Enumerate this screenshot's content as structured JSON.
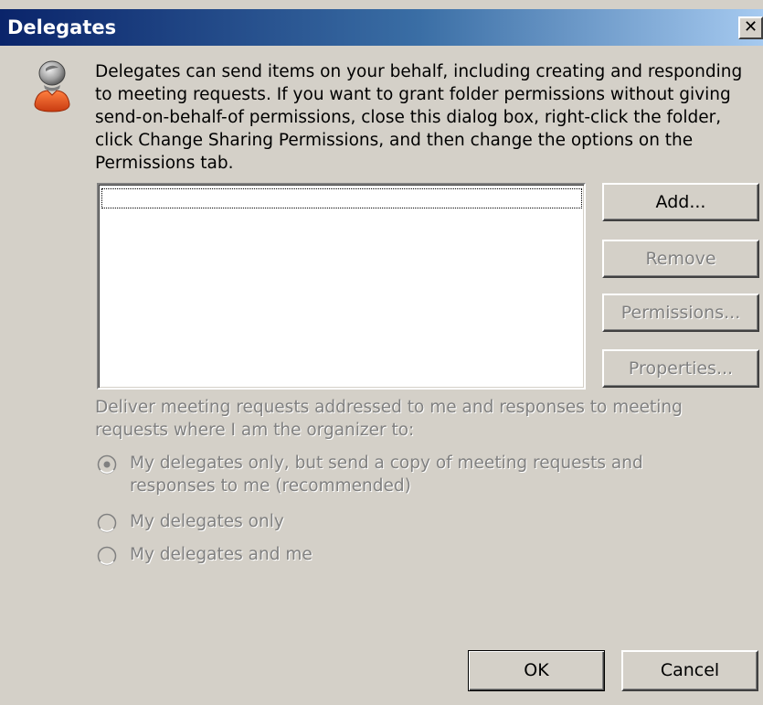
{
  "dialog": {
    "title": "Delegates",
    "close_glyph": "✕",
    "description": "Delegates can send items on your behalf, including creating and responding to meeting requests. If you want to grant folder permissions without giving send-on-behalf-of permissions, close this dialog box, right-click the folder, click Change Sharing Permissions, and then change the options on the Permissions tab.",
    "icon": "user-icon",
    "delegates_list": [],
    "buttons": {
      "add": "Add...",
      "remove": "Remove",
      "permissions": "Permissions...",
      "properties": "Properties...",
      "ok": "OK",
      "cancel": "Cancel"
    },
    "deliver_label": "Deliver meeting requests addressed to me and responses to meeting requests where I am the organizer to:",
    "radio_options": [
      {
        "label": "My delegates only, but send a copy of meeting requests and responses to me (recommended)",
        "selected": true,
        "enabled": false
      },
      {
        "label": "My delegates only",
        "selected": false,
        "enabled": false
      },
      {
        "label": "My delegates and me",
        "selected": false,
        "enabled": false
      }
    ]
  },
  "colors": {
    "face": "#d4d0c8",
    "title_start": "#0a246a",
    "title_end": "#a6caf0",
    "disabled_text": "#808080",
    "icon_accent": "#e8501e"
  }
}
